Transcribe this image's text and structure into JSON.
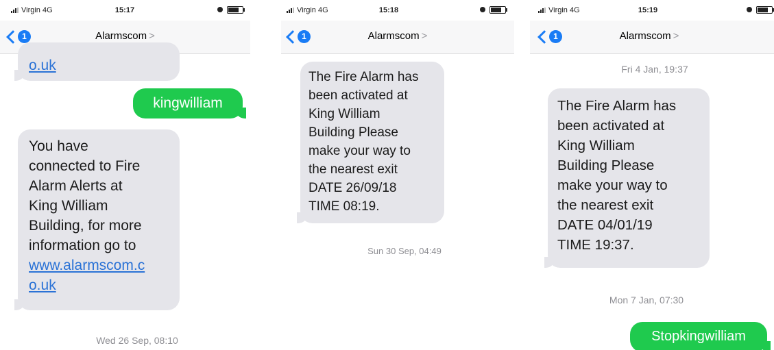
{
  "screen1": {
    "status": {
      "carrier": "Virgin 4G",
      "time": "15:17"
    },
    "nav": {
      "back_badge": "1",
      "title": "Alarmscom",
      "arrow": ">"
    },
    "partial_bubble_text": "o.uk",
    "sent_message": "kingwilliam",
    "received_lines": [
      "You have",
      "connected to Fire",
      "Alarm Alerts at",
      "King William",
      "Building, for more",
      "information go to"
    ],
    "received_link_lines": [
      "www.alarmscom.c",
      "o.uk"
    ],
    "timestamp_bottom": "Wed 26 Sep, 08:10"
  },
  "screen2": {
    "status": {
      "carrier": "Virgin 4G",
      "time": "15:18"
    },
    "nav": {
      "back_badge": "1",
      "title": "Alarmscom",
      "arrow": ">"
    },
    "message_lines": [
      "The Fire Alarm has",
      "been activated at",
      "King William",
      "Building Please",
      "make your way to",
      "the nearest exit",
      "DATE 26/09/18",
      "TIME 08:19."
    ],
    "timestamp": "Sun 30 Sep, 04:49"
  },
  "screen3": {
    "status": {
      "carrier": "Virgin 4G",
      "time": "15:19"
    },
    "nav": {
      "back_badge": "1",
      "title": "Alarmscom",
      "arrow": ">"
    },
    "timestamp_top": "Fri 4 Jan, 19:37",
    "message_lines": [
      "The Fire Alarm has",
      "been activated at",
      "King William",
      "Building Please",
      "make your way to",
      "the nearest exit",
      "DATE 04/01/19",
      "TIME 19:37."
    ],
    "timestamp_mid": "Mon 7 Jan, 07:30",
    "sent_message": "Stopkingwilliam"
  },
  "colors": {
    "accent": "#1a7cf5",
    "incoming_bubble": "#e5e5ea",
    "outgoing_bubble": "#1fca4e",
    "link": "#2a72d6",
    "timestamp": "#8e8e93"
  },
  "icons": [
    "signal-icon",
    "alarm-clock-icon",
    "battery-icon",
    "chevron-left-icon",
    "chevron-right-icon"
  ]
}
